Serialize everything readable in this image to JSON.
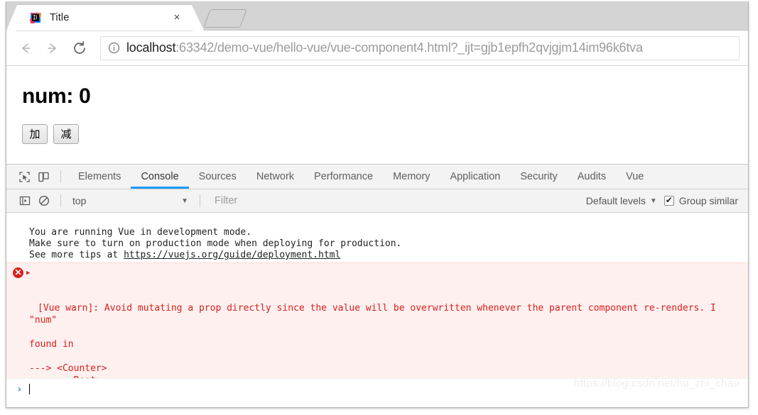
{
  "browser": {
    "tab": {
      "title": "Title",
      "favicon": "intellij-idea-icon",
      "close_label": "×"
    },
    "new_tab_label": "",
    "nav": {
      "back": "←",
      "forward": "→",
      "reload": "↻"
    },
    "omnibox": {
      "info_icon": "info-circle-icon",
      "url_host": "localhost",
      "url_rest": ":63342/demo-vue/hello-vue/vue-component4.html?_ijt=gjb1epfh2qvjgjm14im96k6tva",
      "full_url": "localhost:63342/demo-vue/hello-vue/vue-component4.html?_ijt=gjb1epfh2qvjgjm14im96k6tva"
    }
  },
  "page": {
    "heading": "num: 0",
    "buttons": [
      {
        "label": "加",
        "name": "increment-button"
      },
      {
        "label": "减",
        "name": "decrement-button"
      }
    ]
  },
  "devtools": {
    "toolbar_icons": [
      {
        "name": "inspect-element-icon"
      },
      {
        "name": "device-toolbar-icon"
      }
    ],
    "tabs": [
      {
        "label": "Elements",
        "selected": false
      },
      {
        "label": "Console",
        "selected": true
      },
      {
        "label": "Sources",
        "selected": false
      },
      {
        "label": "Network",
        "selected": false
      },
      {
        "label": "Performance",
        "selected": false
      },
      {
        "label": "Memory",
        "selected": false
      },
      {
        "label": "Application",
        "selected": false
      },
      {
        "label": "Security",
        "selected": false
      },
      {
        "label": "Audits",
        "selected": false
      },
      {
        "label": "Vue",
        "selected": false
      }
    ],
    "filterbar": {
      "sidebar_icon": "console-sidebar-icon",
      "clear_icon": "clear-console-icon",
      "context": "top",
      "context_caret": "▼",
      "filter_placeholder": "Filter",
      "filter_value": "",
      "levels_label": "Default levels",
      "levels_caret": "▼",
      "group_similar_label": "Group similar",
      "group_similar_checked": true
    },
    "console": {
      "info_message": {
        "line1": "You are running Vue in development mode.",
        "line2": "Make sure to turn on production mode when deploying for production.",
        "line3_prefix": "See more tips at ",
        "line3_link": "https://vuejs.org/guide/deployment.html"
      },
      "error_message": {
        "badge": "✕",
        "expand_arrow": "▶",
        "line1": "[Vue warn]: Avoid mutating a prop directly since the value will be overwritten whenever the parent component re-renders. I",
        "line2": "\"num\"",
        "line3": "found in",
        "line4": "---> <Counter>",
        "line5": "       <Root>"
      },
      "prompt_caret": "›",
      "prompt_value": ""
    }
  },
  "watermark": "https://blog.csdn.net/hu_zhi_chao"
}
